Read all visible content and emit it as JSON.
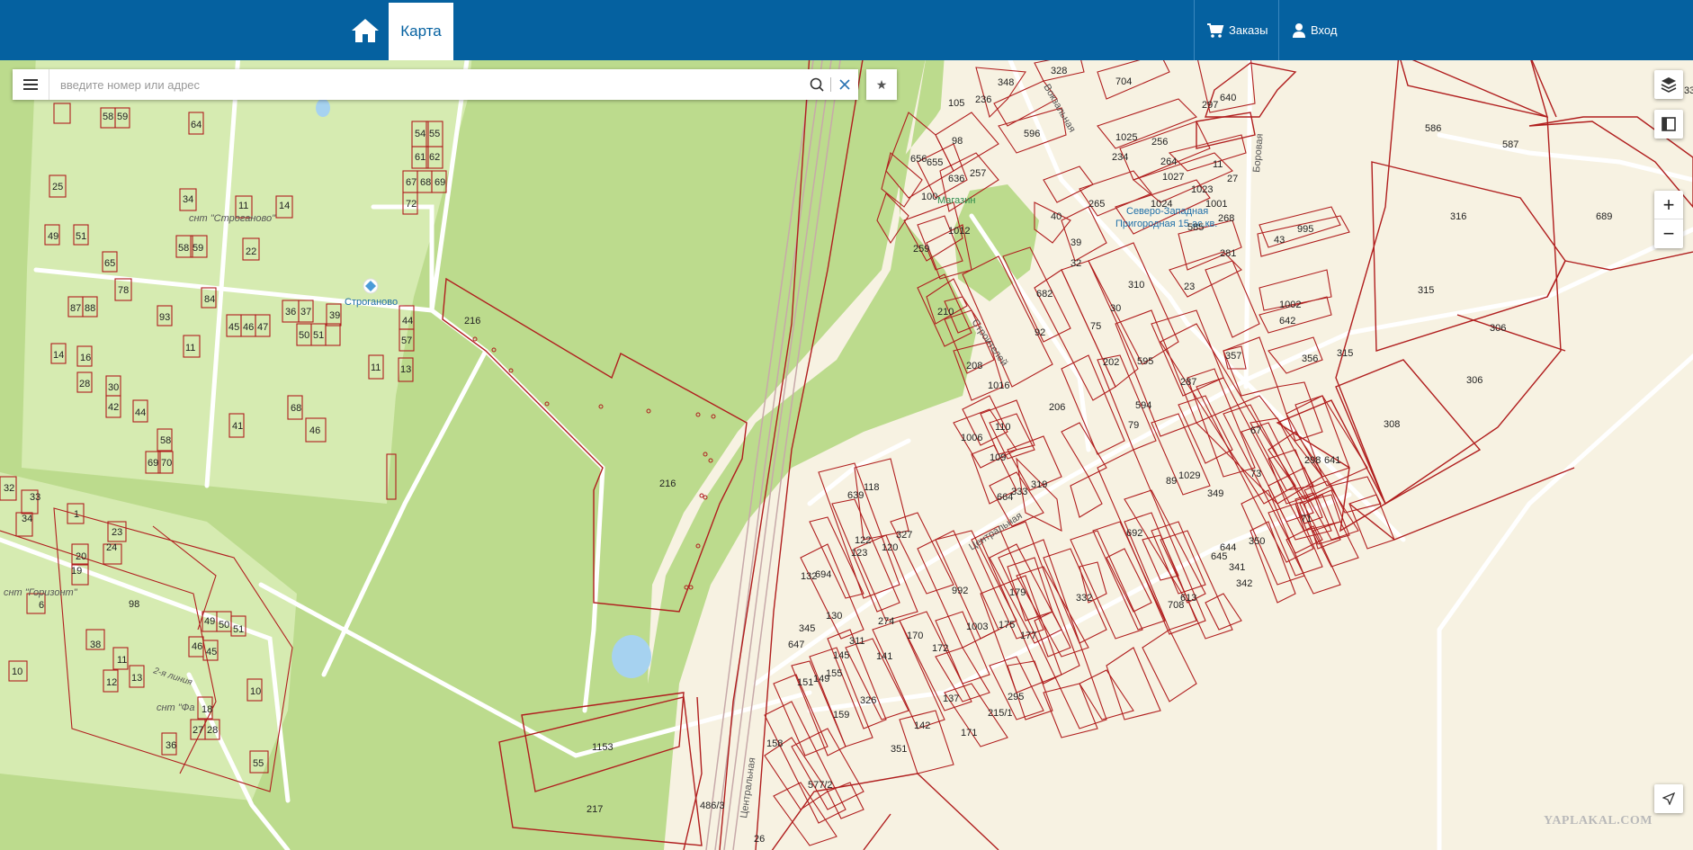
{
  "header": {
    "map_tab_label": "Карта",
    "orders_label": "Заказы",
    "login_label": "Вход"
  },
  "search": {
    "placeholder": "введите номер или адрес",
    "value": ""
  },
  "map": {
    "place_labels": {
      "snt_stroganovo": "снт \"Строганово\"",
      "stroganovo": "Строганово",
      "snt_gorizont": "снт \"Горизонт\"",
      "snt_fa": "снт \"Фа",
      "shop": "Магазин",
      "lzvodskaya": "2-я линия",
      "severo_zapadnaya": "Северо-Западная",
      "gorodskaya": "Пригородная 15 ас.кв."
    },
    "street_labels": {
      "vokzalnaya": "Вокзальная",
      "borovaya": "Боровая",
      "stroiteley": "Строителей",
      "centralnaya": "Центральная",
      "centralnaya2": "Центральная"
    },
    "parcel_numbers": {
      "p216a": "216",
      "p216b": "216",
      "p1153": "1153",
      "p217": "217",
      "p486": "486/3",
      "p58": "58",
      "p59": "59",
      "p64": "64",
      "p54": "54",
      "p55": "55",
      "p61": "61",
      "p62": "62",
      "p67": "67",
      "p68": "68",
      "p69": "69",
      "p72": "72",
      "p25": "25",
      "p34": "34",
      "p11a": "11",
      "p14a": "14",
      "p49": "49",
      "p51": "51",
      "p58b": "58",
      "p59b": "59",
      "p22": "22",
      "p65": "65",
      "p78": "78",
      "p84": "84",
      "p87": "87",
      "p88": "88",
      "p93": "93",
      "p36": "36",
      "p37": "37",
      "p39": "39",
      "p44": "44",
      "p45": "45",
      "p46": "46",
      "p47": "47",
      "p50": "50",
      "p51b": "51",
      "p57": "57",
      "p14b": "14",
      "p16": "16",
      "p11b": "11",
      "p11c": "11",
      "p13": "13",
      "p28": "28",
      "p30": "30",
      "p42": "42",
      "p44b": "44",
      "p68b": "68",
      "p46b": "46",
      "p41": "41",
      "p58c": "58",
      "p69b": "69",
      "p70": "70",
      "p32": "32",
      "p33": "33",
      "p34b": "34",
      "p1": "1",
      "p23": "23",
      "p24": "24",
      "p20": "20",
      "p19": "19",
      "p6": "6",
      "p98": "98",
      "p49b": "49",
      "p50b": "50",
      "p51c": "51",
      "p38": "38",
      "p46c": "46",
      "p45b": "45",
      "p10a": "10",
      "p11d": "11",
      "p12": "12",
      "p13b": "13",
      "p10b": "10",
      "p18": "18",
      "p27": "27",
      "p28b": "28",
      "p36b": "36",
      "p55b": "55",
      "p105": "105",
      "p348": "348",
      "p328": "328",
      "p704": "704",
      "p236": "236",
      "p596": "596",
      "p98c": "98",
      "p656": "656",
      "p655": "655",
      "p257": "257",
      "p636": "636",
      "p100": "100",
      "p1012": "1012",
      "p259": "259",
      "p297": "297",
      "p640": "640",
      "p1025": "1025",
      "p256": "256",
      "p234": "234",
      "p264": "264",
      "p11e": "11",
      "p1027": "1027",
      "p27b": "27",
      "p1023": "1023",
      "p1024": "1024",
      "p1001": "1001",
      "p585": "585",
      "p268": "268",
      "p40": "40",
      "p265": "265",
      "p39b": "39",
      "p32b": "32",
      "p281": "281",
      "p23b": "23",
      "p43": "43",
      "p995": "995",
      "p1002": "1002",
      "p642": "642",
      "p356": "356",
      "p315a": "315",
      "p586": "586",
      "p587": "587",
      "p316": "316",
      "p689": "689",
      "p315b": "315",
      "p306a": "306",
      "p306b": "306",
      "p308": "308",
      "p298": "298",
      "p641": "641",
      "p682": "682",
      "p310": "310",
      "p30b": "30",
      "p210": "210",
      "p92": "92",
      "p75": "75",
      "p595": "595",
      "p287": "287",
      "p357": "357",
      "p202": "202",
      "p208": "208",
      "p1016": "1016",
      "p206": "206",
      "p594": "594",
      "p79": "79",
      "p67b": "67",
      "p1006": "1006",
      "p110": "110",
      "p109": "109",
      "p664": "664",
      "p333": "333",
      "p319": "319",
      "p73": "73",
      "p1029": "1029",
      "p89": "89",
      "p349": "349",
      "p71": "71",
      "p118": "118",
      "p639": "639",
      "p327": "327",
      "p122": "122",
      "p120": "120",
      "p123": "123",
      "p692": "692",
      "p644": "644",
      "p350": "350",
      "p645": "645",
      "p341": "341",
      "p342": "342",
      "p613": "613",
      "p708": "708",
      "p132": "132",
      "p694": "694",
      "p992": "992",
      "p179": "179",
      "p332": "332",
      "p130": "130",
      "p345": "345",
      "p274": "274",
      "p1003": "1003",
      "p175": "175",
      "p170": "170",
      "p172": "172",
      "p177": "177",
      "p647": "647",
      "p311": "311",
      "p145": "145",
      "p141": "141",
      "p151": "151",
      "p149": "149",
      "p155": "155",
      "p137": "137",
      "p295": "295",
      "p159": "159",
      "p326": "326",
      "p142": "142",
      "p2151": "215/1",
      "p171": "171",
      "p351": "351",
      "p158": "158",
      "p5772": "577/2",
      "p335": "33",
      "p264b": "26"
    }
  }
}
